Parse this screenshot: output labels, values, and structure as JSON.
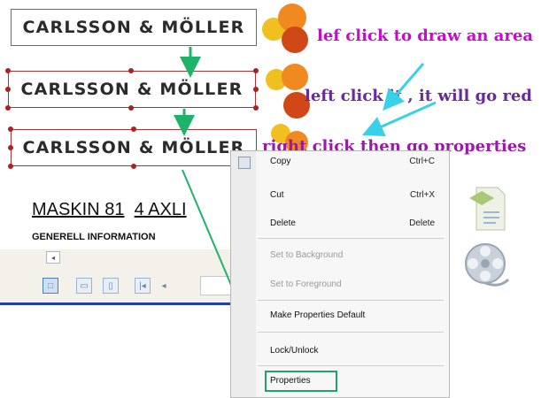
{
  "logo": {
    "text": "CARLSSON & MÖLLER"
  },
  "annotations": {
    "step1": "lef click to draw an area",
    "step2": "left click it , it will go red",
    "step3": "right click then go properties"
  },
  "document": {
    "title_underlined": "MASKIN 81",
    "title_rest": "4 AXLI",
    "subtitle": "GENERELL INFORMATION"
  },
  "toolbar": {
    "scroll_left_glyph": "◂",
    "prev_glyph": "|◂",
    "back_glyph": "◂"
  },
  "context_menu": {
    "items": [
      {
        "label": "Copy",
        "shortcut": "Ctrl+C",
        "enabled": true
      },
      {
        "label": "Cut",
        "shortcut": "Ctrl+X",
        "enabled": true
      },
      {
        "label": "Delete",
        "shortcut": "Delete",
        "enabled": true
      },
      {
        "label": "Set to Background",
        "shortcut": "",
        "enabled": false
      },
      {
        "label": "Set to Foreground",
        "shortcut": "",
        "enabled": false
      },
      {
        "label": "Make Properties Default",
        "shortcut": "",
        "enabled": true
      },
      {
        "label": "Lock/Unlock",
        "shortcut": "",
        "enabled": true
      },
      {
        "label": "Properties",
        "shortcut": "",
        "enabled": true
      }
    ]
  },
  "colors": {
    "annotation_magenta": "#c80ad0",
    "annotation_purple": "#6a2a9a",
    "arrow_green": "#1fb36a",
    "arrow_cyan": "#3ad0e8",
    "selection_red": "#a33333",
    "toolbar_blue": "#1e3ea8"
  },
  "icons": [
    "copy-icon",
    "document-icon",
    "film-reel-icon",
    "decorative-circles-icon"
  ]
}
